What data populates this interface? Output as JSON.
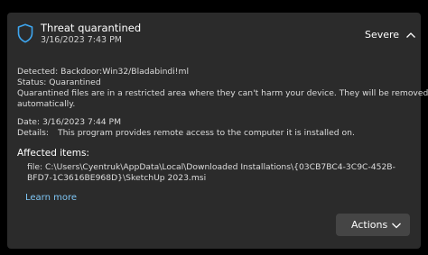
{
  "notification": {
    "title": "Threat quarantined",
    "timestamp": "3/16/2023 7:43 PM",
    "severity": "Severe",
    "detected_line": "Detected:  Backdoor:Win32/Bladabindi!ml",
    "status_line": "Status:  Quarantined",
    "message_line1": "Quarantined files are in a restricted area where they can't harm your device. They will be removed",
    "message_line2": "automatically.",
    "date_line": "Date:  3/16/2023 7:44 PM",
    "details_label": "Details:",
    "details_text": "This program provides remote access to the computer it is installed on.",
    "affected_heading": "Affected items:",
    "file_line1": "file: C:\\Users\\Cyentruk\\AppData\\Local\\Downloaded Installations\\{03CB7BC4-3C9C-452B-",
    "file_line2": "BFD7-1C3616BE968D}\\SketchUp 2023.msi",
    "learn_more": "Learn more",
    "actions_label": "Actions"
  },
  "icons": {
    "header": "shield-icon",
    "collapse": "chevron-up-icon",
    "actions": "chevron-down-icon"
  },
  "colors": {
    "accent": "#3ea6ef",
    "link": "#7fc6f5",
    "card": "#2b2b2b",
    "button": "#454545"
  }
}
